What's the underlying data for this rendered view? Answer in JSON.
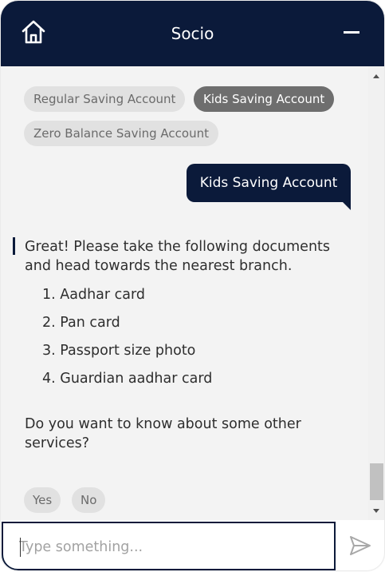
{
  "header": {
    "title": "Socio",
    "home_icon": "home-icon",
    "minimize_icon": "minimize-icon"
  },
  "quick_replies": [
    {
      "label": "Regular Saving Account",
      "selected": false
    },
    {
      "label": "Kids Saving Account",
      "selected": true
    },
    {
      "label": "Zero Balance Saving Account",
      "selected": false
    }
  ],
  "user_message": "Kids Saving Account",
  "bot_message": {
    "intro": "Great! Please take the following documents and head towards the nearest branch.",
    "documents": [
      "1. Aadhar card",
      "2. Pan card",
      "3. Passport size photo",
      "4. Guardian aadhar card"
    ],
    "followup": "Do you want to know about some other services?"
  },
  "answer_options": [
    "Yes",
    "No"
  ],
  "composer": {
    "placeholder": "Type something...",
    "value": "",
    "send_icon": "send-icon"
  },
  "colors": {
    "brand": "#0b1a3a",
    "chip": "#e1e1e1",
    "chip_selected": "#6e6e6e",
    "background": "#f3f3f3"
  }
}
